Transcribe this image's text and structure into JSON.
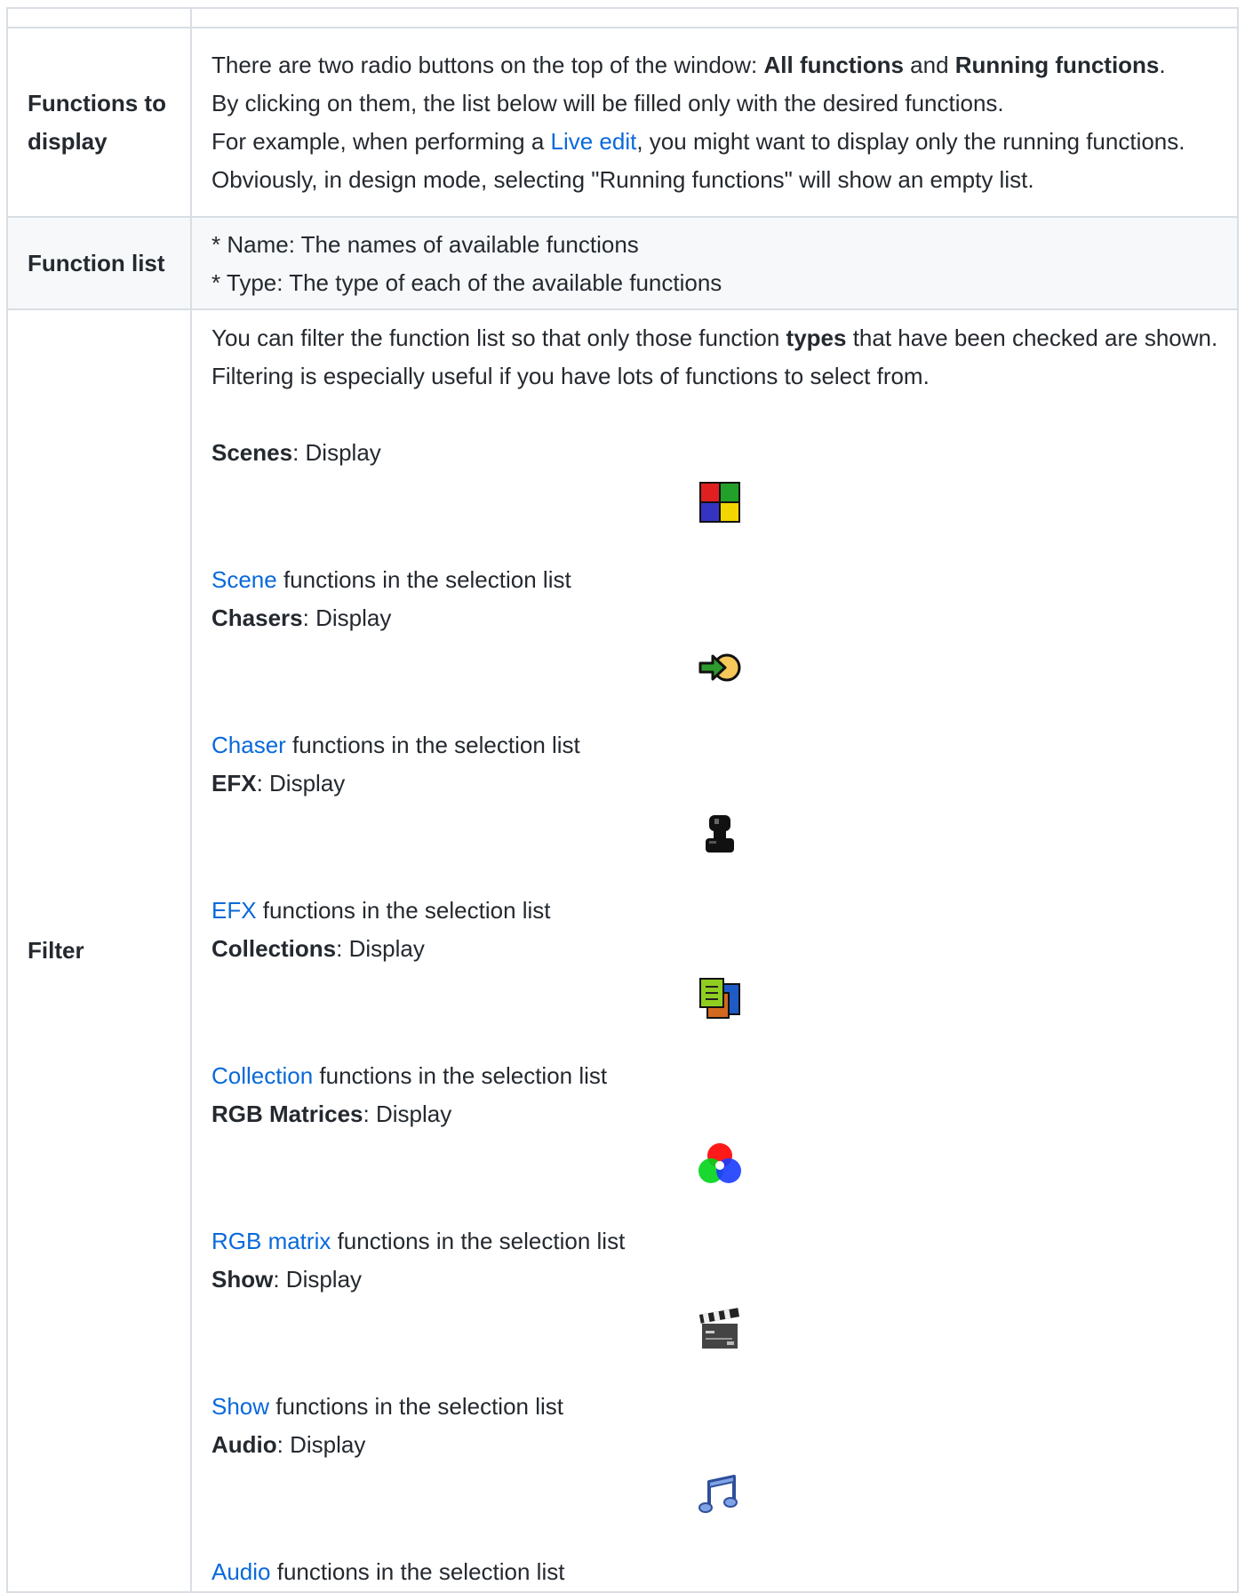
{
  "rows": {
    "functions_to_display": {
      "header": "Functions to display",
      "line1_pre": "There are two radio buttons on the top of the window: ",
      "line1_b1": "All functions",
      "line1_mid": " and ",
      "line1_b2": "Running functions",
      "line1_end": ".",
      "line2": "By clicking on them, the list below will be filled only with the desired functions.",
      "line3_pre": "For example, when performing a ",
      "line3_link": "Live edit",
      "line3_post": ", you might want to display only the running functions.",
      "line4": "Obviously, in design mode, selecting \"Running functions\" will show an empty list."
    },
    "function_list": {
      "header": "Function list",
      "item1": "* Name: The names of available functions",
      "item2": "* Type: The type of each of the available functions"
    },
    "filter": {
      "header": "Filter",
      "intro_pre": "You can filter the function list so that only those function ",
      "intro_bold": "types",
      "intro_post": " that have been checked are shown. Filtering is especially useful if you have lots of functions to select from.",
      "items": [
        {
          "label": "Scenes",
          "display": ": Display",
          "link": "Scene",
          "suffix": " functions in the selection list",
          "icon": "scene-icon"
        },
        {
          "label": "Chasers",
          "display": ": Display",
          "link": "Chaser",
          "suffix": " functions in the selection list",
          "icon": "chaser-icon"
        },
        {
          "label": "EFX",
          "display": ": Display",
          "link": "EFX",
          "suffix": " functions in the selection list",
          "icon": "efx-icon"
        },
        {
          "label": "Collections",
          "display": ": Display",
          "link": "Collection",
          "suffix": " functions in the selection list",
          "icon": "collection-icon"
        },
        {
          "label": "RGB Matrices",
          "display": ": Display",
          "link": "RGB matrix",
          "suffix": " functions in the selection list",
          "icon": "rgb-matrix-icon"
        },
        {
          "label": "Show",
          "display": ": Display",
          "link": "Show",
          "suffix": " functions in the selection list",
          "icon": "show-icon"
        },
        {
          "label": "Audio",
          "display": ": Display",
          "link": "Audio",
          "suffix": " functions in the selection list",
          "icon": "audio-icon"
        }
      ]
    }
  },
  "colors": {
    "text": "#24292f",
    "link": "#0969da",
    "border": "#d8dee4",
    "shade": "#f6f8fa"
  }
}
